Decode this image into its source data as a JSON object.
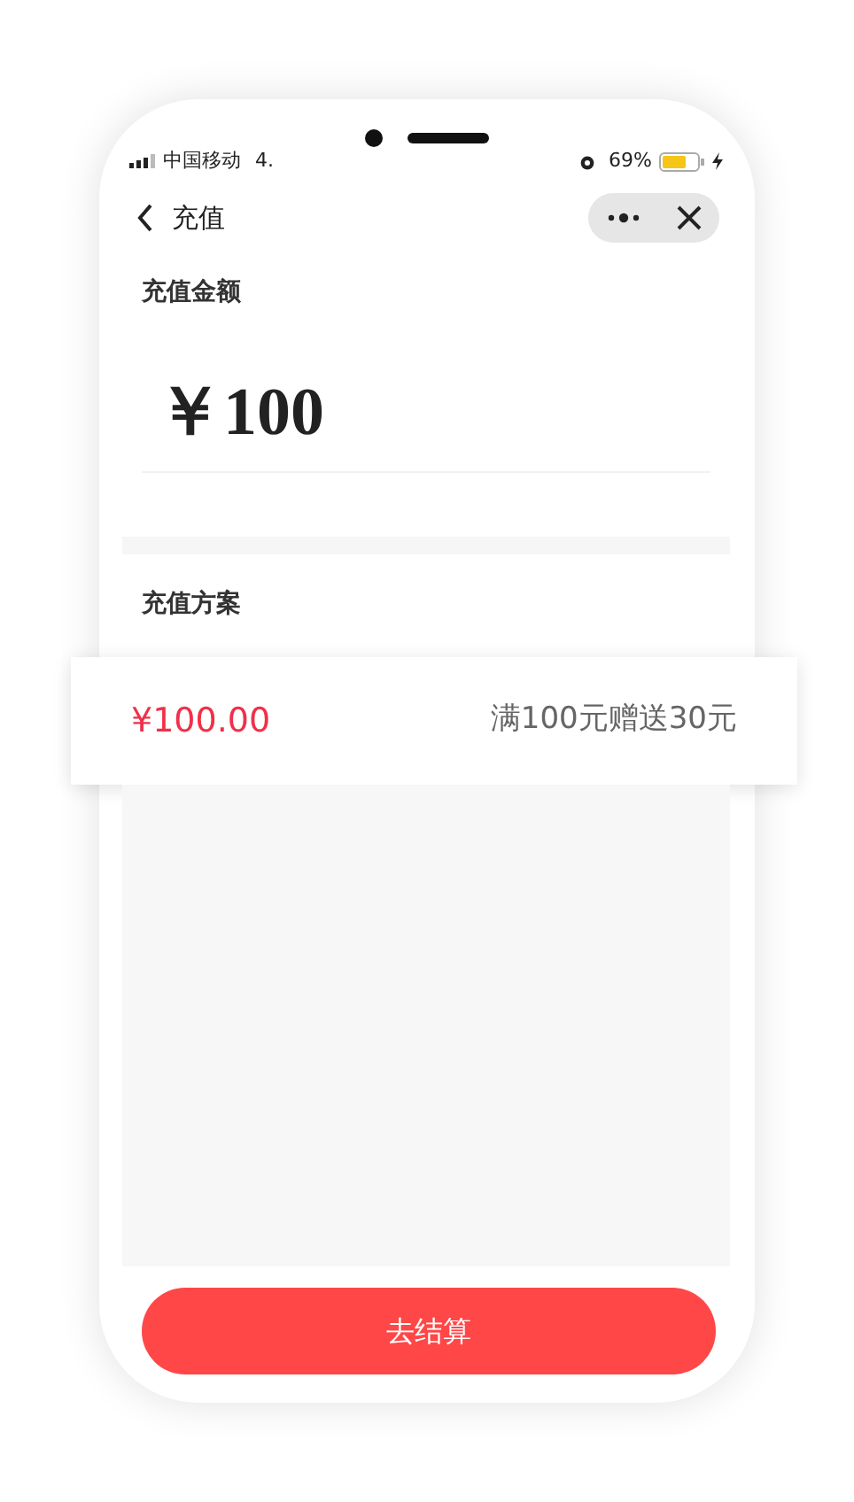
{
  "status_bar": {
    "carrier": "中国移动",
    "network": "4.",
    "battery": "69%"
  },
  "nav": {
    "title": "充值"
  },
  "amount_section": {
    "title": "充值金额",
    "amount": "￥100"
  },
  "plan_section": {
    "title": "充值方案",
    "plans": [
      {
        "price": "¥100.00",
        "description": "满100元赠送30元",
        "selected": true
      }
    ]
  },
  "checkout_button": "去结算"
}
